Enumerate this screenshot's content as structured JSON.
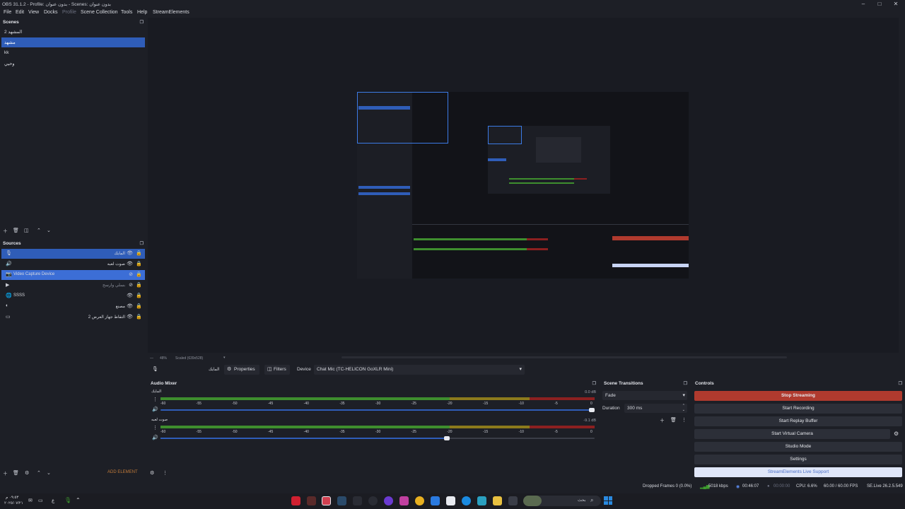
{
  "window": {
    "title": "OBS 31.1.2 - Profile: بدون عنوان - Scenes: بدون عنوان",
    "minimize": "–",
    "maximize": "□",
    "close": "✕"
  },
  "menu": [
    "File",
    "Edit",
    "View",
    "Docks",
    "Profile",
    "Scene Collection",
    "Tools",
    "Help",
    "StreamElements"
  ],
  "scenes": {
    "title": "Scenes",
    "items": [
      "المشهد 2",
      "مشهد",
      "kk",
      "وحيي"
    ],
    "selected_index": 1
  },
  "sources": {
    "title": "Sources",
    "items": [
      {
        "name": "المايك",
        "icon": "mic-icon"
      },
      {
        "name": "صوت لعبه",
        "icon": "speaker-icon"
      },
      {
        "name": "Video Capture Device",
        "icon": "camera-icon"
      },
      {
        "name": "بسلي وارسح",
        "icon": "play-icon"
      },
      {
        "name": "SSSS",
        "icon": "globe-icon"
      },
      {
        "name": "مصنع",
        "icon": "browser-icon"
      },
      {
        "name": "التقاط جهاز العرض 2",
        "icon": "display-icon"
      }
    ],
    "add_element": "ADD ELEMENT"
  },
  "preview_footer": {
    "zoom": "48%",
    "scaled": "Scaled (639x528)"
  },
  "properties_bar": {
    "source_name": "المايك",
    "properties_label": "Properties",
    "filters_label": "Filters",
    "device_label": "Device",
    "device_value": "Chat Mic (TC-HELICON GoXLR Mini)"
  },
  "audio_mixer": {
    "title": "Audio Mixer",
    "channels": [
      {
        "name": "المايك",
        "db": "0.0 dB",
        "volume_fraction": 1.0
      },
      {
        "name": "صوت لعبه",
        "db": "-9.1 dB",
        "volume_fraction": 0.66
      }
    ],
    "ticks": [
      "-60",
      "-55",
      "-50",
      "-45",
      "-40",
      "-35",
      "-30",
      "-25",
      "-20",
      "-15",
      "-10",
      "-5",
      "0"
    ]
  },
  "scene_transitions": {
    "title": "Scene Transitions",
    "transition": "Fade",
    "duration_label": "Duration",
    "duration_value": "300 ms"
  },
  "controls": {
    "title": "Controls",
    "stop_streaming": "Stop Streaming",
    "start_recording": "Start Recording",
    "start_replay_buffer": "Start Replay Buffer",
    "start_virtual_camera": "Start Virtual Camera",
    "studio_mode": "Studio Mode",
    "settings": "Settings",
    "live_support": "StreamElements Live Support"
  },
  "statusbar": {
    "dropped_frames": "Dropped Frames 0 (0.0%)",
    "bitrate": "5018 kbps",
    "stream_time": "00:46:07",
    "record_time": "00:00:00",
    "cpu": "CPU: 6.6%",
    "fps": "60.00 / 60.00 FPS",
    "se_live": "SE.Live 26.2.5.549"
  },
  "taskbar": {
    "time": "٠٩:٥٣ م",
    "date": "٢٠٢٥/٠٧/٢١",
    "lang": "ع",
    "search_text": "بحث"
  },
  "colors": {
    "accent": "#2f5db8",
    "stop_streaming": "#c0392b",
    "meter_green": "#3e8e2e",
    "meter_yellow": "#8c7a1c",
    "meter_red": "#8c2020"
  }
}
